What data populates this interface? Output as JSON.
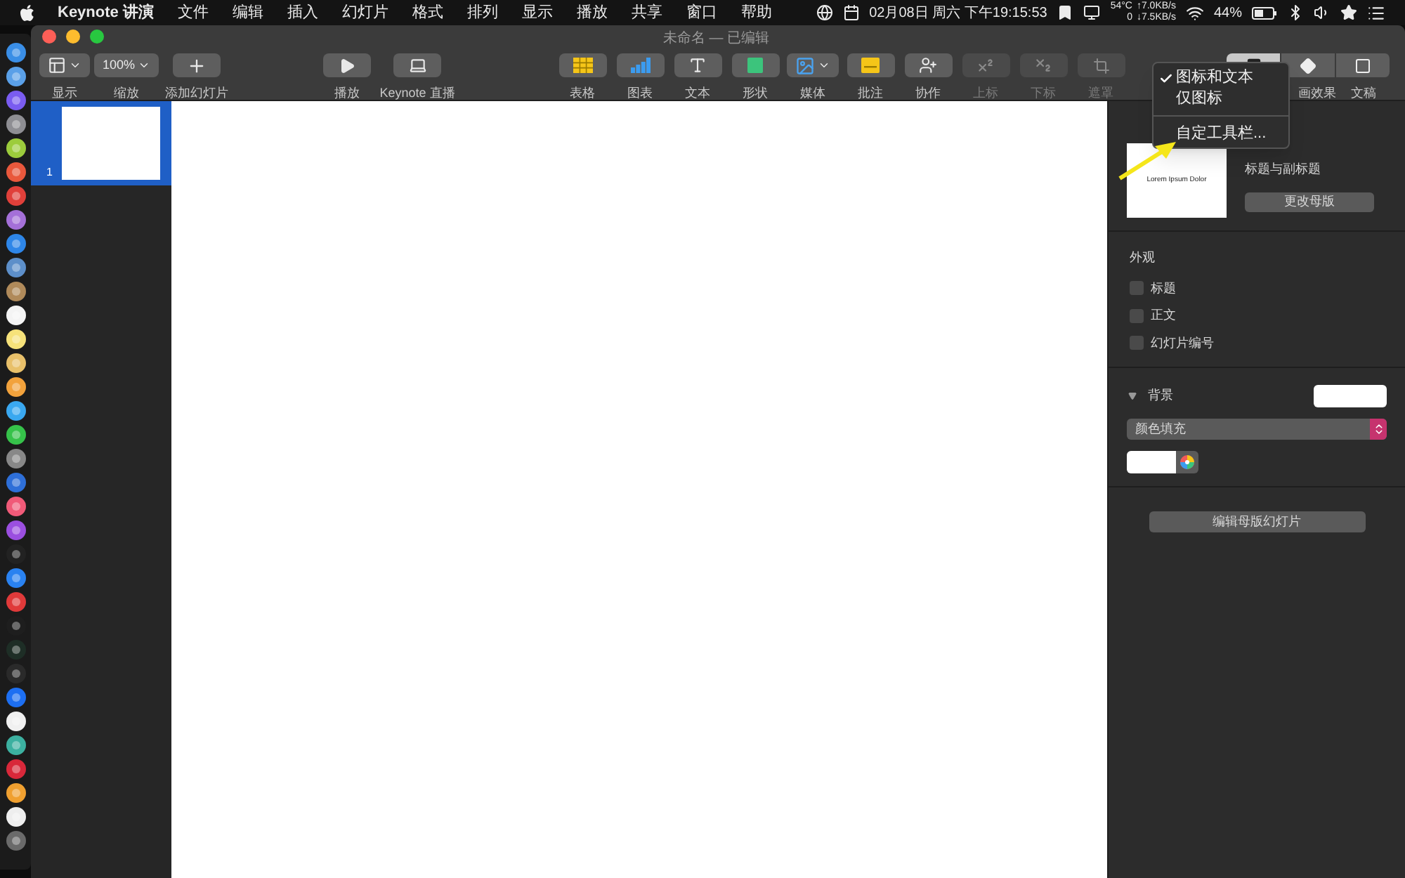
{
  "menubar": {
    "app": "Keynote 讲演",
    "menus": [
      "文件",
      "编辑",
      "插入",
      "幻灯片",
      "格式",
      "排列",
      "显示",
      "播放",
      "共享",
      "窗口",
      "帮助"
    ],
    "status": {
      "datetime": "02月08日 周六 下午19:15:53",
      "temperature": "54°C",
      "cpu": "0",
      "upload": "↑7.0KB/s",
      "download": "↓7.5KB/s",
      "battery": "44%"
    }
  },
  "window": {
    "title": "未命名 — 已编辑"
  },
  "toolbar": {
    "groups": [
      [
        {
          "label": "显示",
          "kind": "view",
          "menu": true,
          "disabled": false
        },
        {
          "label": "缩放",
          "value": "100%",
          "kind": "zoom",
          "menu": true,
          "disabled": false
        },
        {
          "label": "添加幻灯片",
          "kind": "plus",
          "menu": false,
          "disabled": false
        }
      ],
      [
        {
          "label": "播放",
          "kind": "play",
          "menu": false,
          "disabled": false
        },
        {
          "label": "Keynote 直播",
          "kind": "broadcast",
          "menu": false,
          "disabled": false
        }
      ],
      [
        {
          "label": "表格",
          "kind": "table",
          "menu": false,
          "disabled": false
        },
        {
          "label": "图表",
          "kind": "chart",
          "menu": false,
          "disabled": false
        },
        {
          "label": "文本",
          "kind": "text",
          "menu": false,
          "disabled": false
        },
        {
          "label": "形状",
          "kind": "shape",
          "menu": false,
          "disabled": false
        },
        {
          "label": "媒体",
          "kind": "media",
          "menu": true,
          "disabled": false
        },
        {
          "label": "批注",
          "kind": "comment",
          "menu": false,
          "disabled": false
        },
        {
          "label": "协作",
          "kind": "collaborate",
          "menu": false,
          "disabled": false
        },
        {
          "label": "上标",
          "kind": "superscript",
          "menu": false,
          "disabled": true
        },
        {
          "label": "下标",
          "kind": "subscript",
          "menu": false,
          "disabled": true
        },
        {
          "label": "遮罩",
          "kind": "mask",
          "menu": false,
          "disabled": true
        }
      ]
    ],
    "inspector_tabs": [
      {
        "kind": "format",
        "selected": true
      },
      {
        "label": "画效果",
        "kind": "animate",
        "selected": false
      },
      {
        "label": "文稿",
        "kind": "document",
        "selected": false
      }
    ]
  },
  "toolbar_menu": {
    "items": [
      {
        "label": "图标和文本",
        "checked": true
      },
      {
        "label": "仅图标",
        "checked": false
      }
    ],
    "footer_items": [
      "自定工具栏..."
    ]
  },
  "slides": [
    {
      "number": "1",
      "selected": true
    }
  ],
  "inspector": {
    "layout": {
      "preview_title": "Lorem Ipsum Dolor",
      "name": "标题与副标题",
      "button": "更改母版"
    },
    "appearance": {
      "title": "外观",
      "options": [
        {
          "label": "标题",
          "checked": false
        },
        {
          "label": "正文",
          "checked": false
        },
        {
          "label": "幻灯片编号",
          "checked": false
        }
      ]
    },
    "background": {
      "title": "背景",
      "expanded": true,
      "fill_type": "颜色填充"
    },
    "edit_button": "编辑母版幻灯片"
  }
}
